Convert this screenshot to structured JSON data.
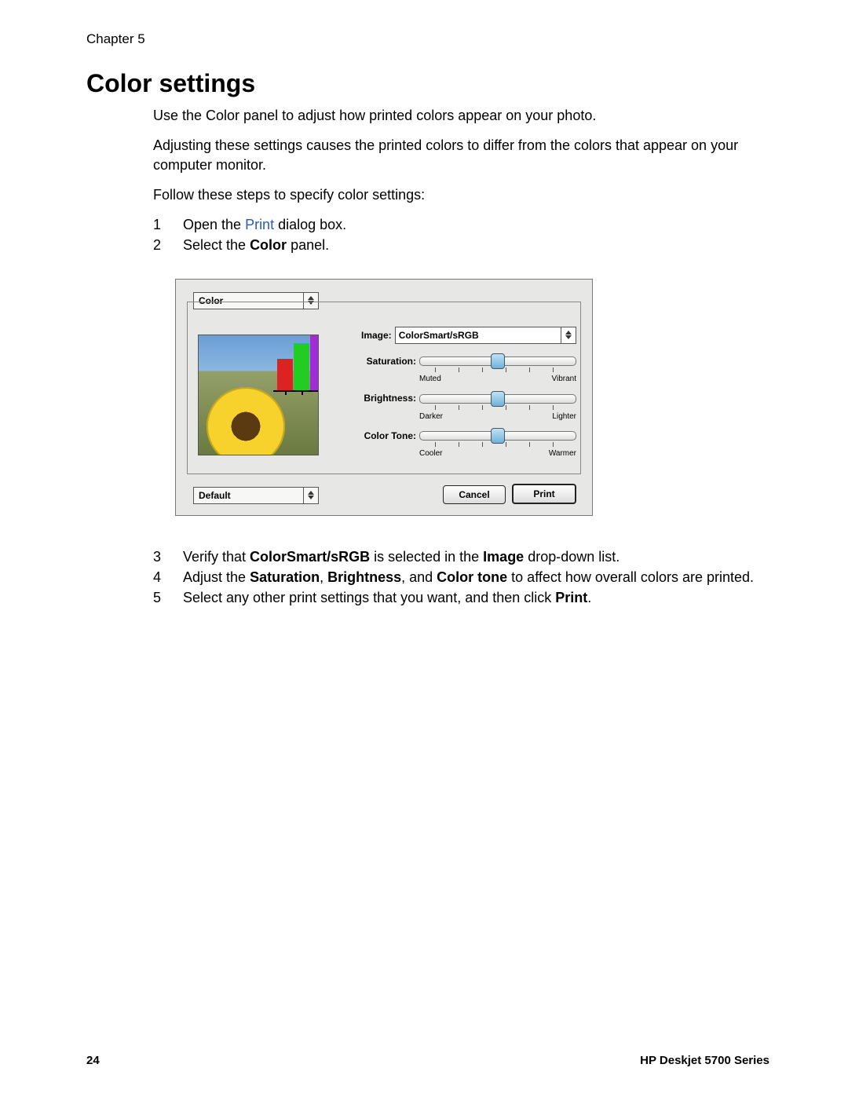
{
  "chapter": "Chapter 5",
  "heading": "Color settings",
  "para1": "Use the Color panel to adjust how printed colors appear on your photo.",
  "para2": "Adjusting these settings causes the printed colors to differ from the colors that appear on your computer monitor.",
  "para3": "Follow these steps to specify color settings:",
  "steps_a": [
    {
      "num": "1",
      "pre": "Open the ",
      "link": "Print",
      "post": " dialog box."
    },
    {
      "num": "2",
      "pre": "Select the ",
      "bold": "Color",
      "post": " panel."
    }
  ],
  "steps_b": {
    "s3": {
      "num": "3",
      "t1": "Verify that ",
      "b1": "ColorSmart/sRGB",
      "t2": " is selected in the ",
      "b2": "Image",
      "t3": " drop-down list."
    },
    "s4": {
      "num": "4",
      "t1": "Adjust the ",
      "b1": "Saturation",
      "t2": ", ",
      "b2": "Brightness",
      "t3": ", and ",
      "b3": "Color tone",
      "t4": " to affect how overall colors are printed."
    },
    "s5": {
      "num": "5",
      "t1": "Select any other print settings that you want, and then click ",
      "b1": "Print",
      "t2": "."
    }
  },
  "dialog": {
    "tab": "Color",
    "image_label": "Image:",
    "image_value": "ColorSmart/sRGB",
    "sliders": [
      {
        "label": "Saturation:",
        "left": "Muted",
        "right": "Vibrant",
        "pos": 50
      },
      {
        "label": "Brightness:",
        "left": "Darker",
        "right": "Lighter",
        "pos": 50
      },
      {
        "label": "Color Tone:",
        "left": "Cooler",
        "right": "Warmer",
        "pos": 50
      }
    ],
    "default": "Default",
    "cancel": "Cancel",
    "print": "Print"
  },
  "footer": {
    "page": "24",
    "product": "HP Deskjet 5700 Series"
  }
}
